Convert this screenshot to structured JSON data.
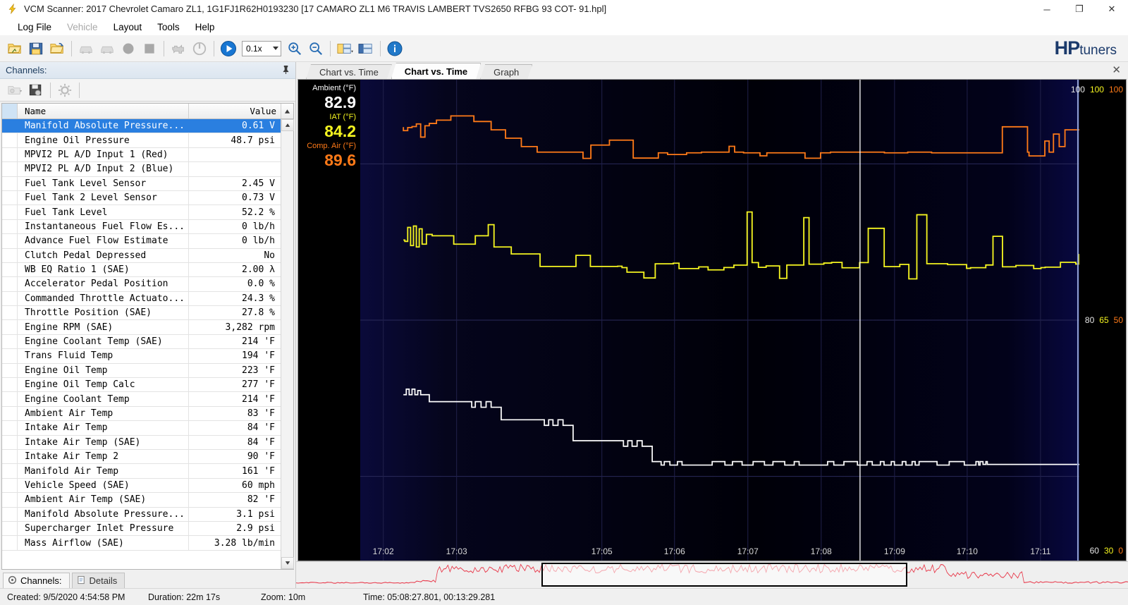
{
  "window": {
    "title": "VCM Scanner: 2017 Chevrolet Camaro ZL1, 1G1FJ1R62H0193230 [17 CAMARO ZL1 M6 TRAVIS LAMBERT TVS2650 RFBG 93 COT- 91.hpl]",
    "app_icon": "lightning-bolt-icon",
    "minimize": "─",
    "maximize": "❐",
    "close": "✕"
  },
  "menu": [
    {
      "label": "Log File",
      "disabled": false
    },
    {
      "label": "Vehicle",
      "disabled": true
    },
    {
      "label": "Layout",
      "disabled": false
    },
    {
      "label": "Tools",
      "disabled": false
    },
    {
      "label": "Help",
      "disabled": false
    }
  ],
  "toolbar": {
    "buttons": [
      {
        "name": "open-file-icon",
        "disabled": false
      },
      {
        "name": "save-file-icon",
        "disabled": false
      },
      {
        "name": "open-recent-icon",
        "disabled": false
      },
      {
        "name": "vehicle-read-icon",
        "disabled": true
      },
      {
        "name": "vehicle-write-icon",
        "disabled": true
      },
      {
        "name": "record-icon",
        "disabled": true
      },
      {
        "name": "stop-icon",
        "disabled": true
      },
      {
        "name": "engine-dtc-icon",
        "disabled": true
      },
      {
        "name": "power-icon",
        "disabled": true
      },
      {
        "name": "play-icon",
        "disabled": false
      },
      {
        "name": "zoom-in-icon",
        "disabled": false
      },
      {
        "name": "zoom-out-icon",
        "disabled": false
      },
      {
        "name": "layout-dropdown-icon",
        "disabled": false
      },
      {
        "name": "layout-save-icon",
        "disabled": false
      },
      {
        "name": "info-icon",
        "disabled": false
      }
    ],
    "playback_rate": "0.1x",
    "brand_hp": "HP",
    "brand_tuners": "tuners"
  },
  "channels": {
    "panel_title": "Channels:",
    "pin_icon": "pin-icon",
    "toolbar_icons": [
      "open-channel-config-icon",
      "save-channel-config-icon",
      "channel-settings-icon"
    ],
    "columns": {
      "name": "Name",
      "value": "Value"
    },
    "sort_icon": "▲",
    "rows": [
      {
        "name": "Manifold Absolute Pressure...",
        "value": "0.61 V",
        "selected": true
      },
      {
        "name": "Engine Oil Pressure",
        "value": "48.7 psi",
        "selected": false
      },
      {
        "name": "MPVI2 PL A/D Input 1 (Red)",
        "value": "",
        "selected": false
      },
      {
        "name": "MPVI2 PL A/D Input 2 (Blue)",
        "value": "",
        "selected": false
      },
      {
        "name": "Fuel Tank Level Sensor",
        "value": "2.45 V",
        "selected": false
      },
      {
        "name": "Fuel Tank 2 Level Sensor",
        "value": "0.73 V",
        "selected": false
      },
      {
        "name": "Fuel Tank Level",
        "value": "52.2 %",
        "selected": false
      },
      {
        "name": "Instantaneous Fuel Flow Es...",
        "value": "0 lb/h",
        "selected": false
      },
      {
        "name": "Advance Fuel Flow Estimate",
        "value": "0 lb/h",
        "selected": false
      },
      {
        "name": "Clutch Pedal Depressed",
        "value": "No",
        "selected": false
      },
      {
        "name": "WB EQ Ratio 1 (SAE)",
        "value": "2.00 λ",
        "selected": false
      },
      {
        "name": "Accelerator Pedal Position",
        "value": "0.0 %",
        "selected": false
      },
      {
        "name": "Commanded Throttle Actuato...",
        "value": "24.3 %",
        "selected": false
      },
      {
        "name": "Throttle Position (SAE)",
        "value": "27.8 %",
        "selected": false
      },
      {
        "name": "Engine RPM (SAE)",
        "value": "3,282 rpm",
        "selected": false
      },
      {
        "name": "Engine Coolant Temp (SAE)",
        "value": "214 'F",
        "selected": false
      },
      {
        "name": "Trans Fluid Temp",
        "value": "194 'F",
        "selected": false
      },
      {
        "name": "Engine Oil Temp",
        "value": "223 'F",
        "selected": false
      },
      {
        "name": "Engine Oil Temp Calc",
        "value": "277 'F",
        "selected": false
      },
      {
        "name": "Engine Coolant Temp",
        "value": "214 'F",
        "selected": false
      },
      {
        "name": "Ambient Air Temp",
        "value": "83 'F",
        "selected": false
      },
      {
        "name": "Intake Air Temp",
        "value": "84 'F",
        "selected": false
      },
      {
        "name": "Intake Air Temp (SAE)",
        "value": "84 'F",
        "selected": false
      },
      {
        "name": "Intake Air Temp 2",
        "value": "90 'F",
        "selected": false
      },
      {
        "name": "Manifold Air Temp",
        "value": "161 'F",
        "selected": false
      },
      {
        "name": "Vehicle Speed (SAE)",
        "value": "60 mph",
        "selected": false
      },
      {
        "name": "Ambient Air Temp (SAE)",
        "value": "82 'F",
        "selected": false
      },
      {
        "name": "Manifold Absolute Pressure...",
        "value": "3.1 psi",
        "selected": false
      },
      {
        "name": "Supercharger Inlet Pressure",
        "value": "2.9 psi",
        "selected": false
      },
      {
        "name": "Mass Airflow (SAE)",
        "value": "3.28 lb/min",
        "selected": false
      }
    ],
    "bottom_tabs": [
      {
        "label": "Channels:",
        "icon": "channels-icon",
        "active": true
      },
      {
        "label": "Details",
        "icon": "details-icon",
        "active": false
      }
    ]
  },
  "chart_tabs": [
    {
      "label": "Chart vs. Time",
      "active": false
    },
    {
      "label": "Chart vs. Time",
      "active": true
    },
    {
      "label": "Graph",
      "active": false
    }
  ],
  "chart_close_icon": "✕",
  "chart_data": {
    "type": "line",
    "title": "Chart vs. Time",
    "xlabel": "",
    "ylabel": "",
    "grid": true,
    "legend_position": "left",
    "background": "#000008",
    "x_tick_labels": [
      "17:02",
      "17:03",
      "17:05",
      "17:06",
      "17:07",
      "17:08",
      "17:09",
      "17:10",
      "17:11"
    ],
    "x_tick_positions_pct": [
      3.2,
      13.4,
      33.6,
      43.7,
      53.9,
      64.1,
      74.3,
      84.4,
      94.6
    ],
    "cursor_position_pct": 69.5,
    "y_axis_rows": [
      {
        "position_pct": 2.0,
        "labels": [
          "100",
          "100",
          "100"
        ]
      },
      {
        "position_pct": 50.0,
        "labels": [
          "80",
          "65",
          "50"
        ]
      },
      {
        "position_pct": 98.0,
        "labels": [
          "60",
          "30",
          "0"
        ]
      }
    ],
    "series": [
      {
        "name": "Comp. Air (°F)",
        "label": "Comp. Air (°F)",
        "value": "89.6",
        "color": "#ff7a18",
        "axis_min": 50,
        "axis_max": 100,
        "axis_mid": 50
      },
      {
        "name": "IAT (°F)",
        "label": "IAT (°F)",
        "value": "84.2",
        "color": "#f5f520",
        "axis_min": 30,
        "axis_max": 100,
        "axis_mid": 65
      },
      {
        "name": "Ambient (°F)",
        "label": "Ambient (°F)",
        "value": "82.9",
        "color": "#ffffff",
        "axis_min": 60,
        "axis_max": 100,
        "axis_mid": 80
      }
    ]
  },
  "overview": {
    "trace_color": "#e8384a",
    "window_left_pct": 29.5,
    "window_width_pct": 44.0
  },
  "statusbar": {
    "created": "Created: 9/5/2020 4:54:58 PM",
    "duration": "Duration: 22m 17s",
    "zoom": "Zoom: 10m",
    "time": "Time: 05:08:27.801, 00:13:29.281"
  }
}
